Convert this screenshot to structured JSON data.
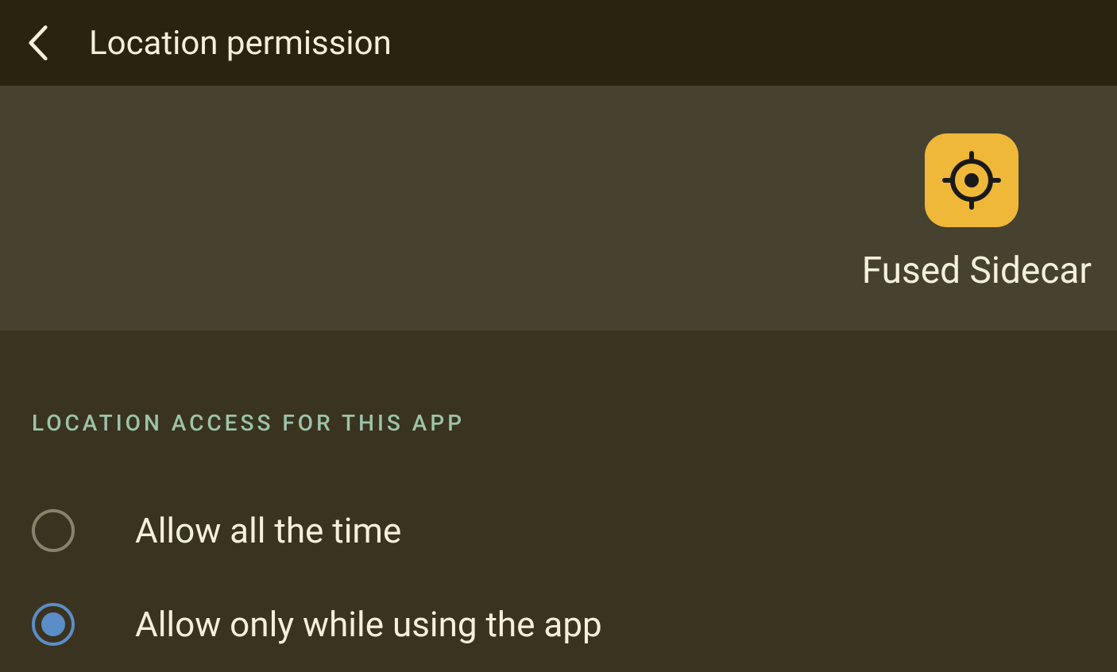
{
  "header": {
    "title": "Location permission"
  },
  "app": {
    "name": "Fused Sidecar",
    "icon_name": "target-location-icon"
  },
  "section": {
    "label": "LOCATION ACCESS FOR THIS APP"
  },
  "options": [
    {
      "label": "Allow all the time",
      "selected": false
    },
    {
      "label": "Allow only while using the app",
      "selected": true
    }
  ]
}
